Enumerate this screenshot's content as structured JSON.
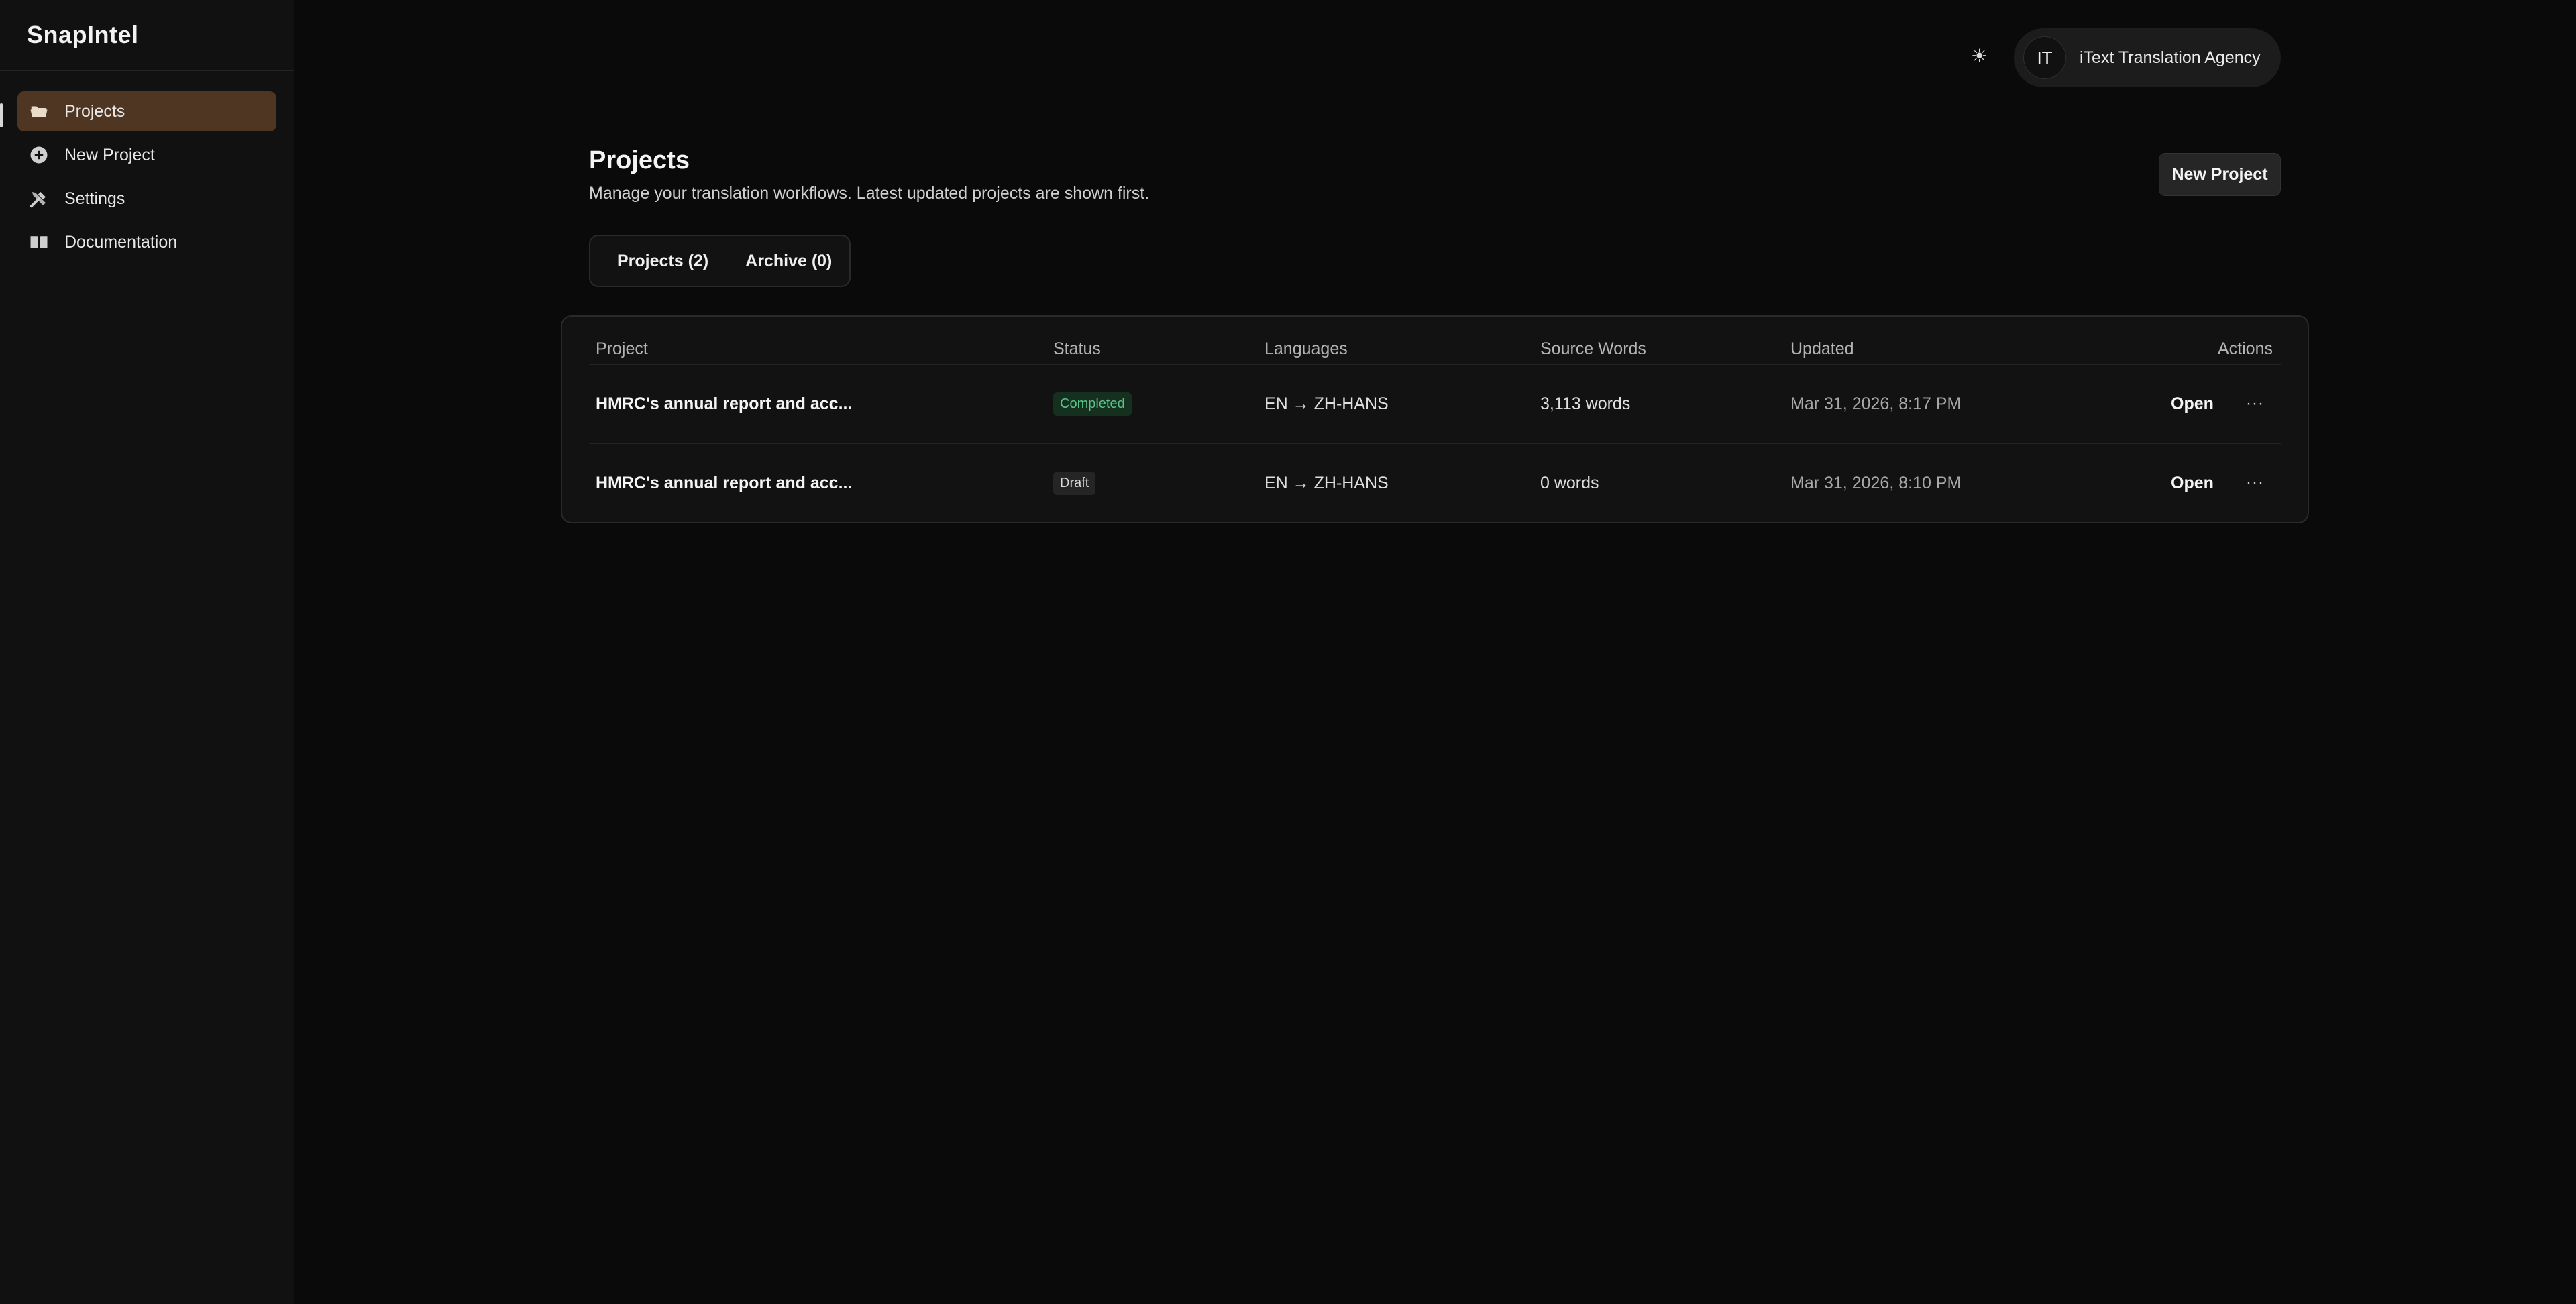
{
  "app": {
    "brand": "SnapIntel"
  },
  "sidebar": {
    "items": [
      {
        "label": "Projects",
        "icon": "folder-open-icon",
        "active": true
      },
      {
        "label": "New Project",
        "icon": "plus-circle-icon",
        "active": false
      },
      {
        "label": "Settings",
        "icon": "tools-icon",
        "active": false
      },
      {
        "label": "Documentation",
        "icon": "book-icon",
        "active": false
      }
    ]
  },
  "topbar": {
    "theme_icon": "☀",
    "account": {
      "initials": "IT",
      "name": "iText Translation Agency"
    }
  },
  "header": {
    "title": "Projects",
    "subtitle": "Manage your translation workflows. Latest updated projects are shown first.",
    "new_project_label": "New Project"
  },
  "tabs": [
    {
      "label": "Projects (2)",
      "active": true
    },
    {
      "label": "Archive (0)",
      "active": false
    }
  ],
  "table": {
    "columns": [
      "Project",
      "Status",
      "Languages",
      "Source Words",
      "Updated",
      "Actions"
    ],
    "rows": [
      {
        "project": "HMRC's annual report and acc...",
        "status": "Completed",
        "languages": "EN → ZH-HANS",
        "source_words": "3,113 words",
        "updated": "Mar 31, 2026, 8:17 PM",
        "action": "Open",
        "more": "···"
      },
      {
        "project": "HMRC's annual report and acc...",
        "status": "Draft",
        "languages": "EN → ZH-HANS",
        "source_words": "0 words",
        "updated": "Mar 31, 2026, 8:10 PM",
        "action": "Open",
        "more": "···"
      }
    ]
  },
  "colors": {
    "background": "#0a0a0a",
    "sidebar": "#111111",
    "active_nav": "#4f3623",
    "completed_text": "#5ac48a",
    "completed_bg": "#15301f"
  }
}
